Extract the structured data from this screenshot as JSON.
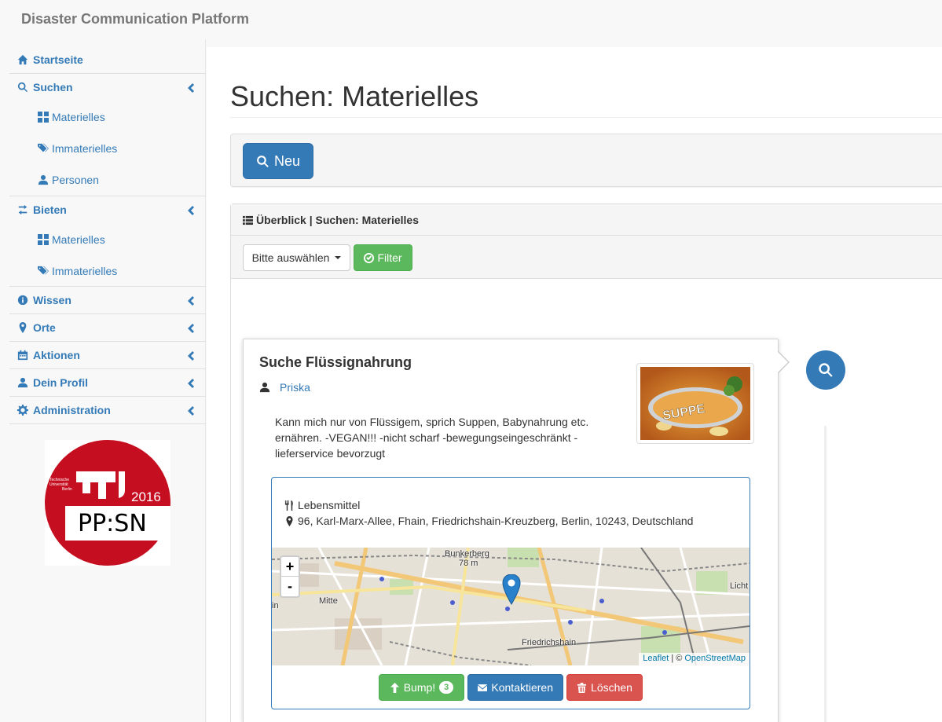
{
  "app": {
    "title": "Disaster Communication Platform"
  },
  "sidebar": {
    "items": [
      {
        "label": "Startseite",
        "icon": "home-icon"
      },
      {
        "label": "Suchen",
        "icon": "search-icon",
        "expanded": true,
        "children": [
          {
            "label": "Materielles",
            "icon": "th-large-icon"
          },
          {
            "label": "Immaterielles",
            "icon": "tags-icon"
          },
          {
            "label": "Personen",
            "icon": "user-icon"
          }
        ]
      },
      {
        "label": "Bieten",
        "icon": "transfer-icon",
        "expanded": true,
        "children": [
          {
            "label": "Materielles",
            "icon": "th-large-icon"
          },
          {
            "label": "Immaterielles",
            "icon": "tags-icon"
          }
        ]
      },
      {
        "label": "Wissen",
        "icon": "info-icon"
      },
      {
        "label": "Orte",
        "icon": "map-marker-icon"
      },
      {
        "label": "Aktionen",
        "icon": "calendar-icon"
      },
      {
        "label": "Dein Profil",
        "icon": "user-icon"
      },
      {
        "label": "Administration",
        "icon": "cog-icon"
      }
    ],
    "logo": {
      "year": "2016",
      "text": "PP:SN",
      "university_lines": [
        "Technische",
        "Universität",
        "Berlin"
      ],
      "colors": {
        "red": "#c50e1f",
        "white": "#ffffff"
      }
    }
  },
  "main": {
    "page_title": "Suchen: Materielles",
    "new_button_label": "Neu",
    "panel_heading": "Überblick | Suchen: Materielles",
    "select_label": "Bitte auswählen",
    "filter_button_label": "Filter"
  },
  "card": {
    "title": "Suche Flüssignahrung",
    "user": "Priska",
    "description": "Kann mich nur von Flüssigem, sprich Suppen, Babynahrung etc. ernähren. -VEGAN!!! -nicht scharf -bewegungseingeschränkt -lieferservice bevorzugt",
    "image_text": "SUPPE",
    "category": "Lebensmittel",
    "address": "96, Karl-Marx-Allee, Fhain, Friedrichshain-Kreuzberg, Berlin, 10243, Deutschland",
    "map": {
      "zoom_in": "+",
      "zoom_out": "-",
      "labels": {
        "bunkerberg": "Bunkerberg",
        "elevation": "78 m",
        "mitte": "Mitte",
        "friedrichshain": "Friedrichshain",
        "licht": "Licht",
        "in": "in"
      },
      "attribution_leaflet": "Leaflet",
      "attribution_sep": "| ©",
      "attribution_osm": "OpenStreetMap"
    },
    "buttons": {
      "bump": "Bump!",
      "bump_count": "3",
      "contact": "Kontaktieren",
      "delete": "Löschen"
    }
  },
  "colors": {
    "primary": "#337ab7",
    "success": "#5cb85c",
    "danger": "#d9534f"
  }
}
